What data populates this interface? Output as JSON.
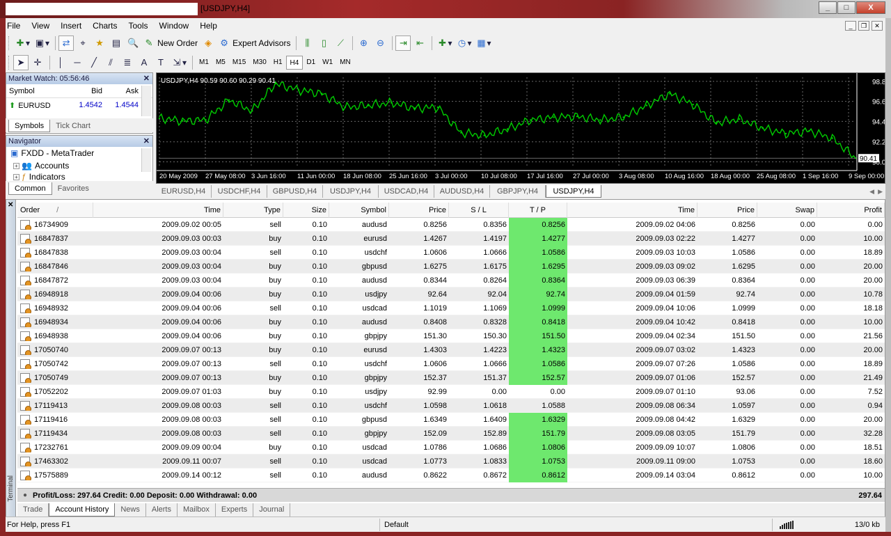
{
  "window": {
    "title": "[USDJPY,H4]",
    "min": "_",
    "max": "□",
    "close": "X"
  },
  "menu": [
    "File",
    "View",
    "Insert",
    "Charts",
    "Tools",
    "Window",
    "Help"
  ],
  "toolbar": {
    "new_order": "New Order",
    "expert_advisors": "Expert Advisors"
  },
  "timeframes": [
    "M1",
    "M5",
    "M15",
    "M30",
    "H1",
    "H4",
    "D1",
    "W1",
    "MN"
  ],
  "active_timeframe": "H4",
  "market_watch": {
    "title": "Market Watch: 05:56:46",
    "headers": {
      "symbol": "Symbol",
      "bid": "Bid",
      "ask": "Ask"
    },
    "rows": [
      {
        "symbol": "EURUSD",
        "bid": "1.4542",
        "ask": "1.4544"
      }
    ],
    "tabs": [
      "Symbols",
      "Tick Chart"
    ]
  },
  "navigator": {
    "title": "Navigator",
    "items": [
      {
        "label": "FXDD - MetaTrader"
      },
      {
        "label": "Accounts"
      },
      {
        "label": "Indicators"
      }
    ],
    "tabs": [
      "Common",
      "Favorites"
    ]
  },
  "chart_data": {
    "type": "line",
    "symbol_label": "USDJPY,H4  90.59 90.60 90.29 90.41",
    "last_value": "90.41",
    "y_ticks": [
      "98.85",
      "96.65",
      "94.45",
      "92.20",
      "90.00"
    ],
    "ylim": [
      89.5,
      99.3
    ],
    "x_ticks": [
      "20 May 2009",
      "27 May 08:00",
      "3 Jun 16:00",
      "11 Jun 00:00",
      "18 Jun 08:00",
      "25 Jun 16:00",
      "3 Jul 00:00",
      "10 Jul 08:00",
      "17 Jul 16:00",
      "27 Jul 00:00",
      "3 Aug 08:00",
      "10 Aug 16:00",
      "18 Aug 00:00",
      "25 Aug 08:00",
      "1 Sep 16:00",
      "9 Sep 00:00"
    ],
    "x": [
      "20 May 2009",
      "24 May 2009",
      "27 May 2009",
      "31 May 2009",
      "3 Jun 2009",
      "7 Jun 2009",
      "11 Jun 2009",
      "15 Jun 2009",
      "18 Jun 2009",
      "22 Jun 2009",
      "25 Jun 2009",
      "29 Jun 2009",
      "3 Jul 2009",
      "6 Jul 2009",
      "10 Jul 2009",
      "14 Jul 2009",
      "17 Jul 2009",
      "21 Jul 2009",
      "27 Jul 2009",
      "30 Jul 2009",
      "3 Aug 2009",
      "7 Aug 2009",
      "10 Aug 2009",
      "14 Aug 2009",
      "18 Aug 2009",
      "21 Aug 2009",
      "25 Aug 2009",
      "29 Aug 2009",
      "1 Sep 2009",
      "5 Sep 2009",
      "9 Sep 2009"
    ],
    "values": [
      94.8,
      94.5,
      94.6,
      96.8,
      95.6,
      98.6,
      97.9,
      97.5,
      96.0,
      96.2,
      96.5,
      95.9,
      96.0,
      93.2,
      92.9,
      93.6,
      94.6,
      94.9,
      95.0,
      94.6,
      94.9,
      96.2,
      97.5,
      96.3,
      94.3,
      94.7,
      93.7,
      93.1,
      93.4,
      92.6,
      90.4
    ],
    "grid": true,
    "background": "#000000",
    "line_color": "#00cc00"
  },
  "chart_tabs": [
    "EURUSD,H4",
    "USDCHF,H4",
    "GBPUSD,H4",
    "USDJPY,H4",
    "USDCAD,H4",
    "AUDUSD,H4",
    "GBPJPY,H4",
    "USDJPY,H4"
  ],
  "active_chart_tab": 7,
  "terminal": {
    "side_label": "Terminal",
    "headers": [
      "Order",
      "Time",
      "Type",
      "Size",
      "Symbol",
      "Price",
      "S / L",
      "T / P",
      "Time",
      "Price",
      "Swap",
      "Profit"
    ],
    "sort_marker": "/",
    "rows": [
      {
        "order": "16734909",
        "time": "2009.09.02 00:05",
        "type": "sell",
        "size": "0.10",
        "symbol": "audusd",
        "price": "0.8256",
        "sl": "0.8356",
        "tp": "0.8256",
        "tp_hit": true,
        "ctime": "2009.09.02 04:06",
        "cprice": "0.8256",
        "swap": "0.00",
        "profit": "0.00"
      },
      {
        "order": "16847837",
        "time": "2009.09.03 00:03",
        "type": "buy",
        "size": "0.10",
        "symbol": "eurusd",
        "price": "1.4267",
        "sl": "1.4197",
        "tp": "1.4277",
        "tp_hit": true,
        "ctime": "2009.09.03 02:22",
        "cprice": "1.4277",
        "swap": "0.00",
        "profit": "10.00"
      },
      {
        "order": "16847838",
        "time": "2009.09.03 00:04",
        "type": "sell",
        "size": "0.10",
        "symbol": "usdchf",
        "price": "1.0606",
        "sl": "1.0666",
        "tp": "1.0586",
        "tp_hit": true,
        "ctime": "2009.09.03 10:03",
        "cprice": "1.0586",
        "swap": "0.00",
        "profit": "18.89"
      },
      {
        "order": "16847846",
        "time": "2009.09.03 00:04",
        "type": "buy",
        "size": "0.10",
        "symbol": "gbpusd",
        "price": "1.6275",
        "sl": "1.6175",
        "tp": "1.6295",
        "tp_hit": true,
        "ctime": "2009.09.03 09:02",
        "cprice": "1.6295",
        "swap": "0.00",
        "profit": "20.00"
      },
      {
        "order": "16847872",
        "time": "2009.09.03 00:04",
        "type": "buy",
        "size": "0.10",
        "symbol": "audusd",
        "price": "0.8344",
        "sl": "0.8264",
        "tp": "0.8364",
        "tp_hit": true,
        "ctime": "2009.09.03 06:39",
        "cprice": "0.8364",
        "swap": "0.00",
        "profit": "20.00"
      },
      {
        "order": "16948918",
        "time": "2009.09.04 00:06",
        "type": "buy",
        "size": "0.10",
        "symbol": "usdjpy",
        "price": "92.64",
        "sl": "92.04",
        "tp": "92.74",
        "tp_hit": true,
        "ctime": "2009.09.04 01:59",
        "cprice": "92.74",
        "swap": "0.00",
        "profit": "10.78"
      },
      {
        "order": "16948932",
        "time": "2009.09.04 00:06",
        "type": "sell",
        "size": "0.10",
        "symbol": "usdcad",
        "price": "1.1019",
        "sl": "1.1069",
        "tp": "1.0999",
        "tp_hit": true,
        "ctime": "2009.09.04 10:06",
        "cprice": "1.0999",
        "swap": "0.00",
        "profit": "18.18"
      },
      {
        "order": "16948934",
        "time": "2009.09.04 00:06",
        "type": "buy",
        "size": "0.10",
        "symbol": "audusd",
        "price": "0.8408",
        "sl": "0.8328",
        "tp": "0.8418",
        "tp_hit": true,
        "ctime": "2009.09.04 10:42",
        "cprice": "0.8418",
        "swap": "0.00",
        "profit": "10.00"
      },
      {
        "order": "16948938",
        "time": "2009.09.04 00:06",
        "type": "buy",
        "size": "0.10",
        "symbol": "gbpjpy",
        "price": "151.30",
        "sl": "150.30",
        "tp": "151.50",
        "tp_hit": true,
        "ctime": "2009.09.04 02:34",
        "cprice": "151.50",
        "swap": "0.00",
        "profit": "21.56"
      },
      {
        "order": "17050740",
        "time": "2009.09.07 00:13",
        "type": "buy",
        "size": "0.10",
        "symbol": "eurusd",
        "price": "1.4303",
        "sl": "1.4223",
        "tp": "1.4323",
        "tp_hit": true,
        "ctime": "2009.09.07 03:02",
        "cprice": "1.4323",
        "swap": "0.00",
        "profit": "20.00"
      },
      {
        "order": "17050742",
        "time": "2009.09.07 00:13",
        "type": "sell",
        "size": "0.10",
        "symbol": "usdchf",
        "price": "1.0606",
        "sl": "1.0666",
        "tp": "1.0586",
        "tp_hit": true,
        "ctime": "2009.09.07 07:26",
        "cprice": "1.0586",
        "swap": "0.00",
        "profit": "18.89"
      },
      {
        "order": "17050749",
        "time": "2009.09.07 00:13",
        "type": "buy",
        "size": "0.10",
        "symbol": "gbpjpy",
        "price": "152.37",
        "sl": "151.37",
        "tp": "152.57",
        "tp_hit": true,
        "ctime": "2009.09.07 01:06",
        "cprice": "152.57",
        "swap": "0.00",
        "profit": "21.49"
      },
      {
        "order": "17052202",
        "time": "2009.09.07 01:03",
        "type": "buy",
        "size": "0.10",
        "symbol": "usdjpy",
        "price": "92.99",
        "sl": "0.00",
        "tp": "0.00",
        "tp_hit": false,
        "ctime": "2009.09.07 01:10",
        "cprice": "93.06",
        "swap": "0.00",
        "profit": "7.52"
      },
      {
        "order": "17119413",
        "time": "2009.09.08 00:03",
        "type": "sell",
        "size": "0.10",
        "symbol": "usdchf",
        "price": "1.0598",
        "sl": "1.0618",
        "tp": "1.0588",
        "tp_hit": false,
        "ctime": "2009.09.08 06:34",
        "cprice": "1.0597",
        "swap": "0.00",
        "profit": "0.94"
      },
      {
        "order": "17119416",
        "time": "2009.09.08 00:03",
        "type": "sell",
        "size": "0.10",
        "symbol": "gbpusd",
        "price": "1.6349",
        "sl": "1.6409",
        "tp": "1.6329",
        "tp_hit": true,
        "ctime": "2009.09.08 04:42",
        "cprice": "1.6329",
        "swap": "0.00",
        "profit": "20.00"
      },
      {
        "order": "17119434",
        "time": "2009.09.08 00:03",
        "type": "sell",
        "size": "0.10",
        "symbol": "gbpjpy",
        "price": "152.09",
        "sl": "152.89",
        "tp": "151.79",
        "tp_hit": true,
        "ctime": "2009.09.08 03:05",
        "cprice": "151.79",
        "swap": "0.00",
        "profit": "32.28"
      },
      {
        "order": "17232761",
        "time": "2009.09.09 00:04",
        "type": "buy",
        "size": "0.10",
        "symbol": "usdcad",
        "price": "1.0786",
        "sl": "1.0686",
        "tp": "1.0806",
        "tp_hit": true,
        "ctime": "2009.09.09 10:07",
        "cprice": "1.0806",
        "swap": "0.00",
        "profit": "18.51"
      },
      {
        "order": "17463302",
        "time": "2009.09.11 00:07",
        "type": "sell",
        "size": "0.10",
        "symbol": "usdcad",
        "price": "1.0773",
        "sl": "1.0833",
        "tp": "1.0753",
        "tp_hit": true,
        "ctime": "2009.09.11 09:00",
        "cprice": "1.0753",
        "swap": "0.00",
        "profit": "18.60"
      },
      {
        "order": "17575889",
        "time": "2009.09.14 00:12",
        "type": "sell",
        "size": "0.10",
        "symbol": "audusd",
        "price": "0.8622",
        "sl": "0.8672",
        "tp": "0.8612",
        "tp_hit": true,
        "ctime": "2009.09.14 03:04",
        "cprice": "0.8612",
        "swap": "0.00",
        "profit": "10.00"
      }
    ],
    "summary": "Profit/Loss: 297.64  Credit: 0.00  Deposit: 0.00  Withdrawal: 0.00",
    "total": "297.64",
    "tabs": [
      "Trade",
      "Account History",
      "News",
      "Alerts",
      "Mailbox",
      "Experts",
      "Journal"
    ],
    "active_tab": 1
  },
  "status": {
    "help": "For Help, press F1",
    "profile": "Default",
    "traffic": "13/0 kb"
  },
  "colors": {
    "tp_hit": "#6ee86e",
    "chart_bg": "#000000",
    "chart_line": "#00cc00",
    "bid_ask": "#0000c8"
  }
}
